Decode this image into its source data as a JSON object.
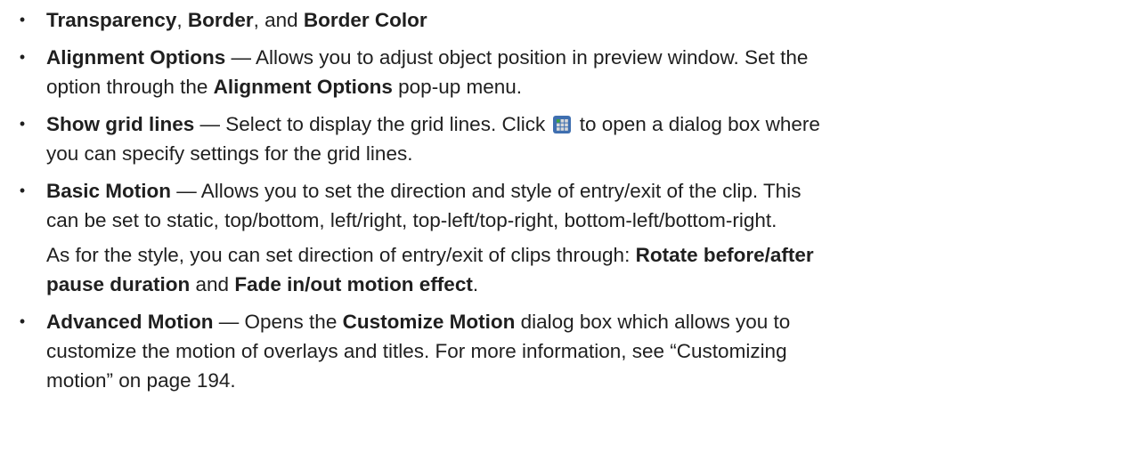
{
  "bullets": [
    {
      "lines": [
        [
          {
            "t": "Transparency",
            "b": true
          },
          {
            "t": ", "
          },
          {
            "t": "Border",
            "b": true
          },
          {
            "t": ", and "
          },
          {
            "t": "Border Color",
            "b": true
          }
        ]
      ]
    },
    {
      "lines": [
        [
          {
            "t": "Alignment Options",
            "b": true
          },
          {
            "t": " — Allows you to adjust object position in preview window. Set the"
          }
        ],
        [
          {
            "t": "option through the "
          },
          {
            "t": "Alignment Options",
            "b": true
          },
          {
            "t": " pop-up menu."
          }
        ]
      ]
    },
    {
      "lines": [
        [
          {
            "t": "Show grid lines",
            "b": true
          },
          {
            "t": " — Select to display the grid lines. Click "
          },
          {
            "icon": "grid-settings-icon"
          },
          {
            "t": " to open a dialog box where"
          }
        ],
        [
          {
            "t": "you can specify settings for the grid lines."
          }
        ]
      ]
    },
    {
      "lines": [
        [
          {
            "t": "Basic Motion",
            "b": true
          },
          {
            "t": " — Allows you to set the direction and style of entry/exit of the clip. This"
          }
        ],
        [
          {
            "t": "can be set to static, top/bottom, left/right, top-left/top-right, bottom-left/bottom-right."
          }
        ],
        [
          {
            "t": "As for the style, you can set direction of entry/exit of clips through: "
          },
          {
            "t": "Rotate before/after",
            "b": true
          }
        ],
        [
          {
            "t": "pause duration",
            "b": true
          },
          {
            "t": " and "
          },
          {
            "t": "Fade in/out motion effect",
            "b": true
          },
          {
            "t": "."
          }
        ]
      ]
    },
    {
      "lines": [
        [
          {
            "t": "Advanced Motion",
            "b": true
          },
          {
            "t": " — Opens the "
          },
          {
            "t": "Customize Motion",
            "b": true
          },
          {
            "t": " dialog box which allows you to"
          }
        ],
        [
          {
            "t": "customize the motion of overlays and titles. For more information, see “Customizing"
          }
        ],
        [
          {
            "t": "motion” on page 194."
          }
        ]
      ]
    }
  ],
  "bullet_marker": "•",
  "icon_colors": {
    "grid_frame": "#3f6fb0",
    "grid_cells": "#d9d9d9",
    "grid_accent": "#3fa33f"
  }
}
